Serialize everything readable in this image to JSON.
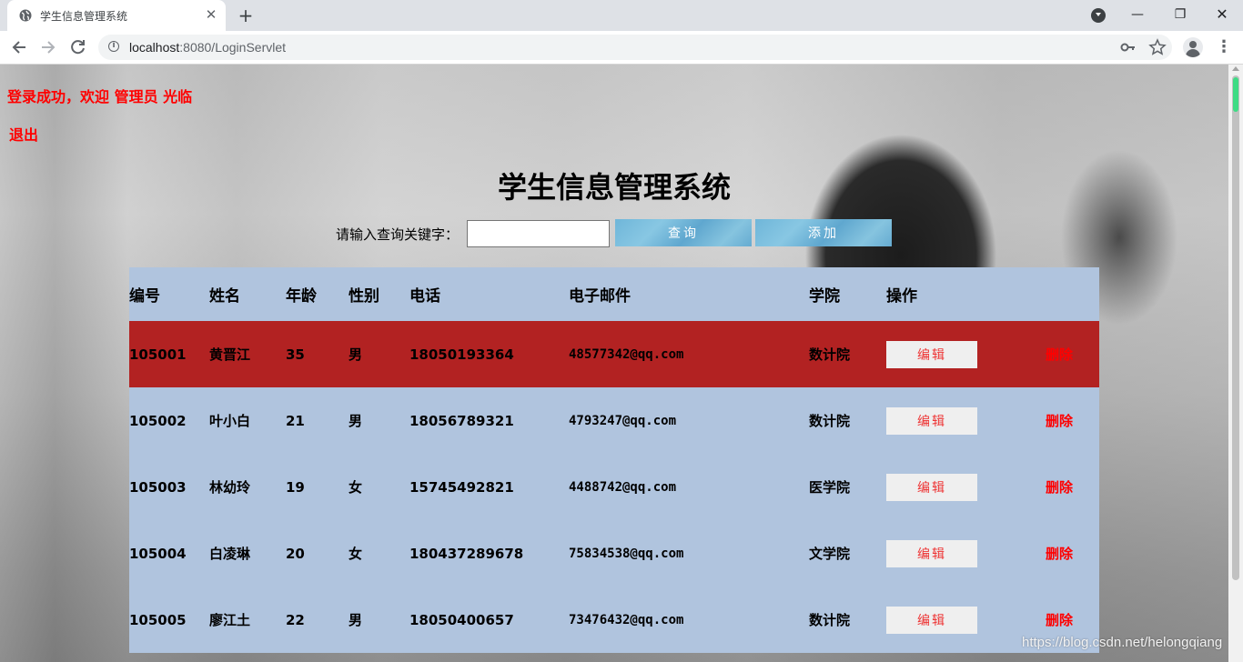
{
  "browser": {
    "tab_title": "学生信息管理系统",
    "tab_close": "✕",
    "new_tab": "+",
    "url_host": "localhost",
    "url_rest": ":8080/LoginServlet",
    "controls": {
      "minimize": "—",
      "restore": "❐",
      "close": "✕"
    },
    "icons": [
      "back-arrow-icon",
      "forward-arrow-icon",
      "reload-icon",
      "info-icon",
      "key-icon",
      "star-icon",
      "account-icon",
      "kebab-menu-icon"
    ]
  },
  "page": {
    "welcome": "登录成功，欢迎 管理员 光临",
    "logout": "退出",
    "title": "学生信息管理系统",
    "search": {
      "label": "请输入查询关键字：",
      "value": "",
      "query_button": "查询",
      "add_button": "添加"
    },
    "table": {
      "headers": {
        "id": "编号",
        "name": "姓名",
        "age": "年龄",
        "sex": "性别",
        "phone": "电话",
        "email": "电子邮件",
        "college": "学院",
        "action": "操作"
      },
      "edit_label": "编辑",
      "delete_label": "删除",
      "highlight_color": "#b22222",
      "background_color": "#b0c4de",
      "rows": [
        {
          "id": "105001",
          "name": "黄晋江",
          "age": "35",
          "sex": "男",
          "phone": "18050193364",
          "email": "48577342@qq.com",
          "college": "数计院"
        },
        {
          "id": "105002",
          "name": "叶小白",
          "age": "21",
          "sex": "男",
          "phone": "18056789321",
          "email": "4793247@qq.com",
          "college": "数计院"
        },
        {
          "id": "105003",
          "name": "林幼玲",
          "age": "19",
          "sex": "女",
          "phone": "15745492821",
          "email": "4488742@qq.com",
          "college": "医学院"
        },
        {
          "id": "105004",
          "name": "白凌琳",
          "age": "20",
          "sex": "女",
          "phone": "180437289678",
          "email": "75834538@qq.com",
          "college": "文学院"
        },
        {
          "id": "105005",
          "name": "廖江土",
          "age": "22",
          "sex": "男",
          "phone": "18050400657",
          "email": "73476432@qq.com",
          "college": "数计院"
        }
      ]
    }
  },
  "watermark": "https://blog.csdn.net/helongqiang"
}
